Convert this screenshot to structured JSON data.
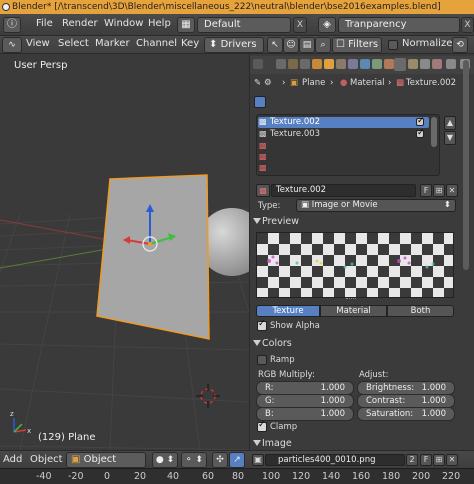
{
  "window": {
    "title": "Blender* [/\\transcend\\3D\\Blender\\miscellaneous_222\\neutral\\blender\\bse2016examples.blend]"
  },
  "infobar": {
    "menus": [
      "File",
      "Render",
      "Window",
      "Help"
    ],
    "screen_layout": "Default",
    "scene": "Tranparency",
    "close_label": "X"
  },
  "editbar": {
    "menus": [
      "View",
      "Select",
      "Marker",
      "Channel",
      "Key"
    ],
    "mode_dropdown": "Drivers",
    "filters_label": "Filters",
    "normalize_label": "Normalize",
    "normalize_checked": false
  },
  "viewport": {
    "view_label": "User Persp",
    "object_label": "(129) Plane"
  },
  "properties": {
    "breadcrumb": [
      "Plane",
      "Material",
      "Texture.002"
    ],
    "texture_slots": [
      {
        "name": "Texture.002",
        "selected": true,
        "enabled": true
      },
      {
        "name": "Texture.003",
        "selected": false,
        "enabled": true
      },
      {
        "name": "",
        "selected": false,
        "enabled": false
      },
      {
        "name": "",
        "selected": false,
        "enabled": false
      },
      {
        "name": "",
        "selected": false,
        "enabled": false
      }
    ],
    "texture_name": "Texture.002",
    "fake_user": "F",
    "type_label": "Type:",
    "type_value": "Image or Movie",
    "preview_header": "Preview",
    "preview_tabs": [
      "Texture",
      "Material",
      "Both"
    ],
    "active_preview_tab": "Texture",
    "show_alpha_label": "Show Alpha",
    "show_alpha_checked": true,
    "colors_header": "Colors",
    "ramp_label": "Ramp",
    "ramp_checked": false,
    "rgb_multiply_label": "RGB Multiply:",
    "adjust_label": "Adjust:",
    "rgb": [
      {
        "label": "R:",
        "value": "1.000"
      },
      {
        "label": "G:",
        "value": "1.000"
      },
      {
        "label": "B:",
        "value": "1.000"
      }
    ],
    "adjust": [
      {
        "label": "Brightness:",
        "value": "1.000"
      },
      {
        "label": "Contrast:",
        "value": "1.000"
      },
      {
        "label": "Saturation:",
        "value": "1.000"
      }
    ],
    "clamp_label": "Clamp",
    "clamp_checked": true,
    "image_header": "Image",
    "image_file": "particles400_0010.png",
    "image_users": "2",
    "image_fake": "F"
  },
  "bottom_header": {
    "menus": [
      "Add",
      "Object"
    ],
    "mode": "Object Mode"
  },
  "timeline": {
    "ticks": [
      "-40",
      "-20",
      "0",
      "20",
      "40",
      "60",
      "80",
      "100",
      "120",
      "140",
      "160",
      "180",
      "200",
      "220",
      "240",
      "260"
    ]
  },
  "colors": {
    "selected_row": "#5680c2",
    "active_tab": "#5680c2",
    "title_bar": "#e6a33c",
    "plane_outline": "#f09a27"
  }
}
